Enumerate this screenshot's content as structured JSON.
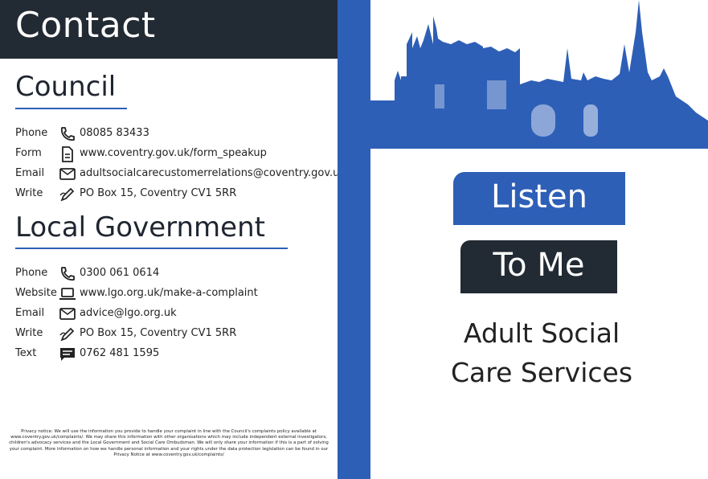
{
  "header": {
    "title": "Contact"
  },
  "council": {
    "title": "Council",
    "rows": [
      {
        "label": "Phone",
        "icon": "phone-icon",
        "value": "08085 83433"
      },
      {
        "label": "Form",
        "icon": "document-icon",
        "value": "www.coventry.gov.uk/form_speakup"
      },
      {
        "label": "Email",
        "icon": "envelope-icon",
        "value": "adultsocialcarecustomerrelations@coventry.gov.uk"
      },
      {
        "label": "Write",
        "icon": "pen-icon",
        "value": "PO Box 15, Coventry CV1 5RR"
      }
    ]
  },
  "lgo": {
    "title": "Local Government",
    "rows": [
      {
        "label": "Phone",
        "icon": "phone-icon",
        "value": "0300 061 0614"
      },
      {
        "label": "Website",
        "icon": "laptop-icon",
        "value": "www.lgo.org.uk/make-a-complaint"
      },
      {
        "label": "Email",
        "icon": "envelope-icon",
        "value": "advice@lgo.org.uk"
      },
      {
        "label": "Write",
        "icon": "pen-icon",
        "value": "PO Box 15, Coventry CV1 5RR"
      },
      {
        "label": "Text",
        "icon": "chat-icon",
        "value": "0762 481 1595"
      }
    ]
  },
  "privacy": "Privacy notice: We will use the information you provide to handle your complaint in line with the Council's complaints policy available at www.coventry.gov.uk/complaints/. We may share this information with other organisations which may include independent external investigators, children's advocacy services and the Local Government and Social Care Ombudsman. We will only share your information if this is a part of solving your complaint. More information on how we handle personal information and your rights under the data protection legislation can be found in our Privacy Notice at www.coventry.gov.uk/complaints/",
  "cover": {
    "line1": "Listen",
    "line2": "To Me",
    "subtitle1": "Adult Social",
    "subtitle2": "Care Services"
  },
  "colors": {
    "blue": "#2e5fb7",
    "navy": "#222a33"
  }
}
